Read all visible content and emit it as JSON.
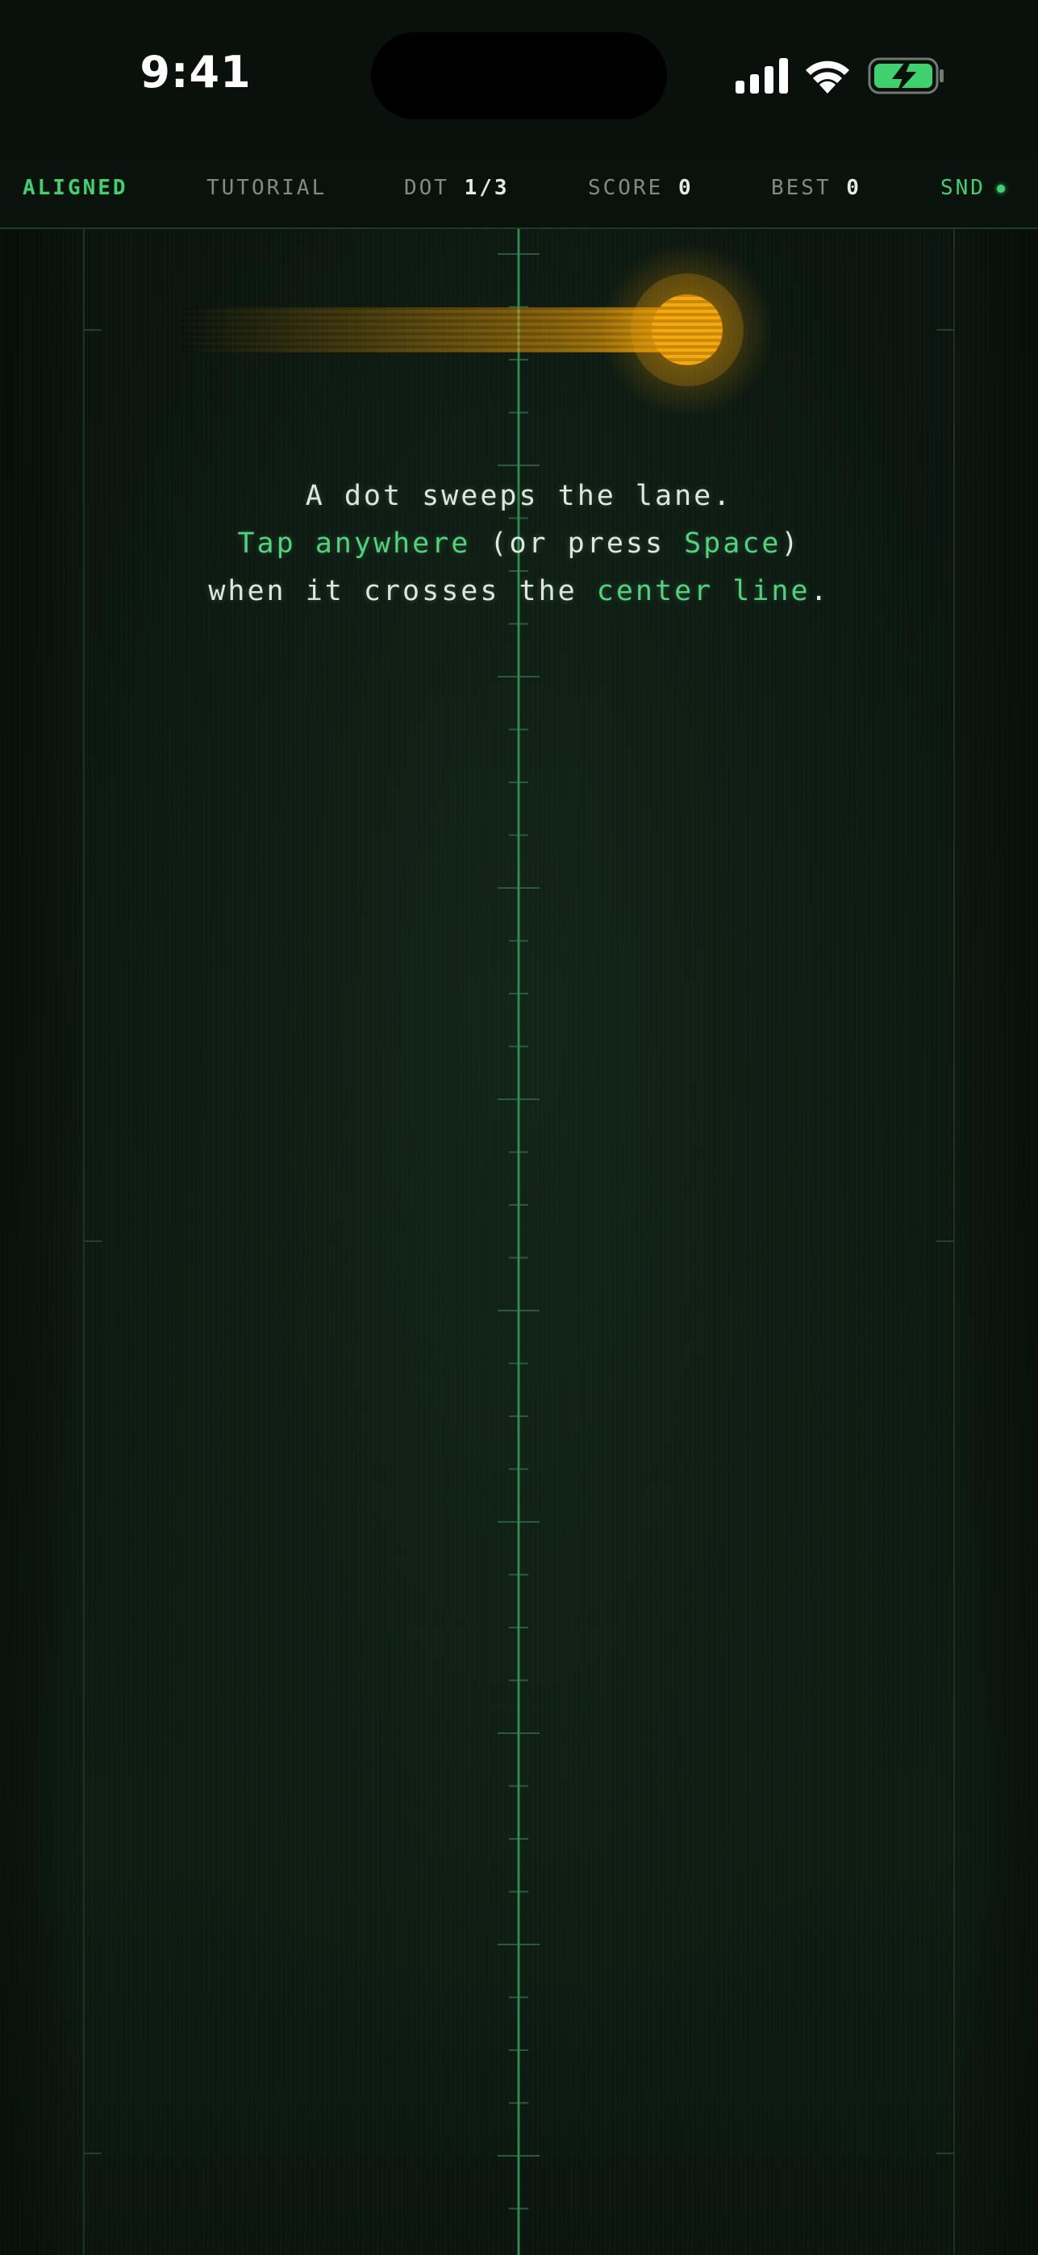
{
  "status_bar": {
    "time": "9:41"
  },
  "hud": {
    "brand": "ALIGNED",
    "mode": "TUTORIAL",
    "dot_label": "DOT",
    "dot_value": "1/3",
    "score_label": "SCORE",
    "score_value": "0",
    "best_label": "BEST",
    "best_value": "0",
    "sound_label": "SND",
    "sound_on": true
  },
  "instructions": {
    "line1": "A dot sweeps the lane.",
    "line2_hl1": "Tap anywhere",
    "line2_mid": " (or press ",
    "line2_hl2": "Space",
    "line2_end": ")",
    "line3_start": "when it crosses the ",
    "line3_hl": "center line",
    "line3_end": "."
  },
  "colors": {
    "accent_green": "#3fd16f",
    "dot_amber": "#f5a50a",
    "background": "#0a120d"
  },
  "icons": [
    "signal-icon",
    "wifi-icon",
    "battery-charging-icon",
    "sound-indicator-icon"
  ]
}
